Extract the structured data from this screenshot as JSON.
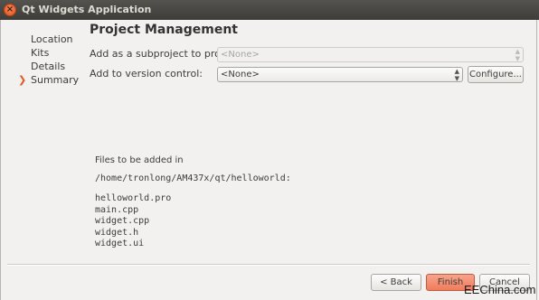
{
  "window": {
    "title": "Qt Widgets Application"
  },
  "sidebar": {
    "items": [
      {
        "label": "Location",
        "active": false
      },
      {
        "label": "Kits",
        "active": false
      },
      {
        "label": "Details",
        "active": false
      },
      {
        "label": "Summary",
        "active": true
      }
    ]
  },
  "page": {
    "title": "Project Management"
  },
  "form": {
    "subproject_label": "Add as a subproject to project:",
    "subproject_value": "<None>",
    "vcs_label": "Add to version control:",
    "vcs_value": "<None>",
    "configure_label": "Configure..."
  },
  "files": {
    "header": "Files to be added in",
    "path": "/home/tronlong/AM437x/qt/helloworld:",
    "items": [
      "helloworld.pro",
      "main.cpp",
      "widget.cpp",
      "widget.h",
      "widget.ui"
    ]
  },
  "footer": {
    "back_label": "< Back",
    "finish_label": "Finish",
    "cancel_label": "Cancel"
  },
  "watermark": "EEChina.com",
  "colors": {
    "accent": "#e05a1c",
    "primary_button": "#ef7c5c",
    "titlebar": "#3e3d39"
  }
}
